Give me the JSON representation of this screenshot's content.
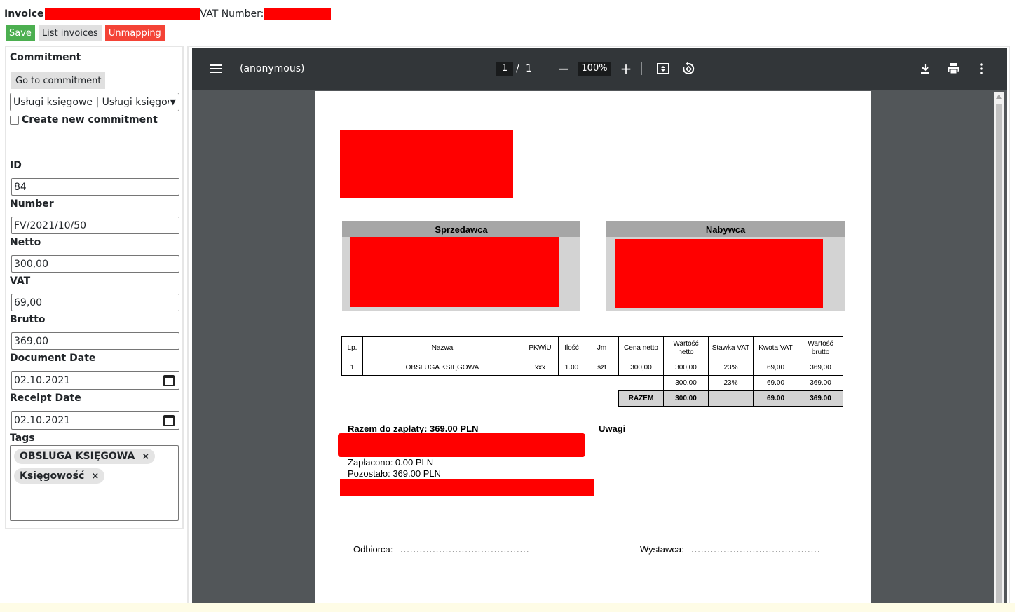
{
  "header": {
    "invoice_label": "Invoice",
    "vat_label": "VAT Number:"
  },
  "toolbar": {
    "save_label": "Save",
    "list_label": "List invoices",
    "unmapping_label": "Unmapping"
  },
  "colors": {
    "save": "#4caf50",
    "unmapping": "#f44336",
    "redaction": "#ff0000",
    "viewer_toolbar": "#323639",
    "viewer_bg": "#525659"
  },
  "commitment": {
    "title": "Commitment",
    "goto_label": "Go to commitment",
    "selected": "Usługi księgowe | Usługi księgowe",
    "create_new_label": "Create new commitment"
  },
  "form": {
    "id_label": "ID",
    "id_value": "84",
    "number_label": "Number",
    "number_value": "FV/2021/10/50",
    "netto_label": "Netto",
    "netto_value": "300,00",
    "vat_label": "VAT",
    "vat_value": "69,00",
    "brutto_label": "Brutto",
    "brutto_value": "369,00",
    "document_date_label": "Document Date",
    "document_date_value": "02.10.2021",
    "receipt_date_label": "Receipt Date",
    "receipt_date_value": "02.10.2021",
    "tags_label": "Tags",
    "tags": [
      "OBSLUGA KSIĘGOWA",
      "Księgowość"
    ],
    "tag_remove": "×"
  },
  "viewer": {
    "title": "(anonymous)",
    "page_current": "1",
    "page_sep": "/",
    "page_total": "1",
    "zoom": "100%",
    "icons": {
      "menu": "menu-icon",
      "zoom_out": "minus-icon",
      "zoom_in": "plus-icon",
      "fit": "fit-page-icon",
      "rotate": "rotate-icon",
      "download": "download-icon",
      "print": "print-icon",
      "more": "more-vertical-icon"
    }
  },
  "pdf": {
    "seller_label": "Sprzedawca",
    "buyer_label": "Nabywca",
    "table": {
      "headers": [
        "Lp.",
        "Nazwa",
        "PKWiU",
        "Ilość",
        "Jm",
        "Cena netto",
        "Wartość netto",
        "Stawka VAT",
        "Kwota VAT",
        "Wartość brutto"
      ],
      "rows": [
        [
          "1",
          "OBSLUGA KSIĘGOWA",
          "xxx",
          "1.00",
          "szt",
          "300,00",
          "300,00",
          "23%",
          "69,00",
          "369,00"
        ]
      ],
      "subtotal": {
        "netto": "300.00",
        "rate": "23%",
        "vat": "69.00",
        "brutto": "369.00"
      },
      "total": {
        "label": "RAZEM",
        "netto": "300.00",
        "vat": "69.00",
        "brutto": "369.00"
      }
    },
    "to_pay": "Razem do zapłaty: 369.00 PLN",
    "notes_label": "Uwagi",
    "paid": "Zapłacono: 0.00 PLN",
    "remaining": "Pozostało: 369.00 PLN",
    "receiver_label": "Odbiorca:",
    "issuer_label": "Wystawca:",
    "dots": "........................................"
  }
}
